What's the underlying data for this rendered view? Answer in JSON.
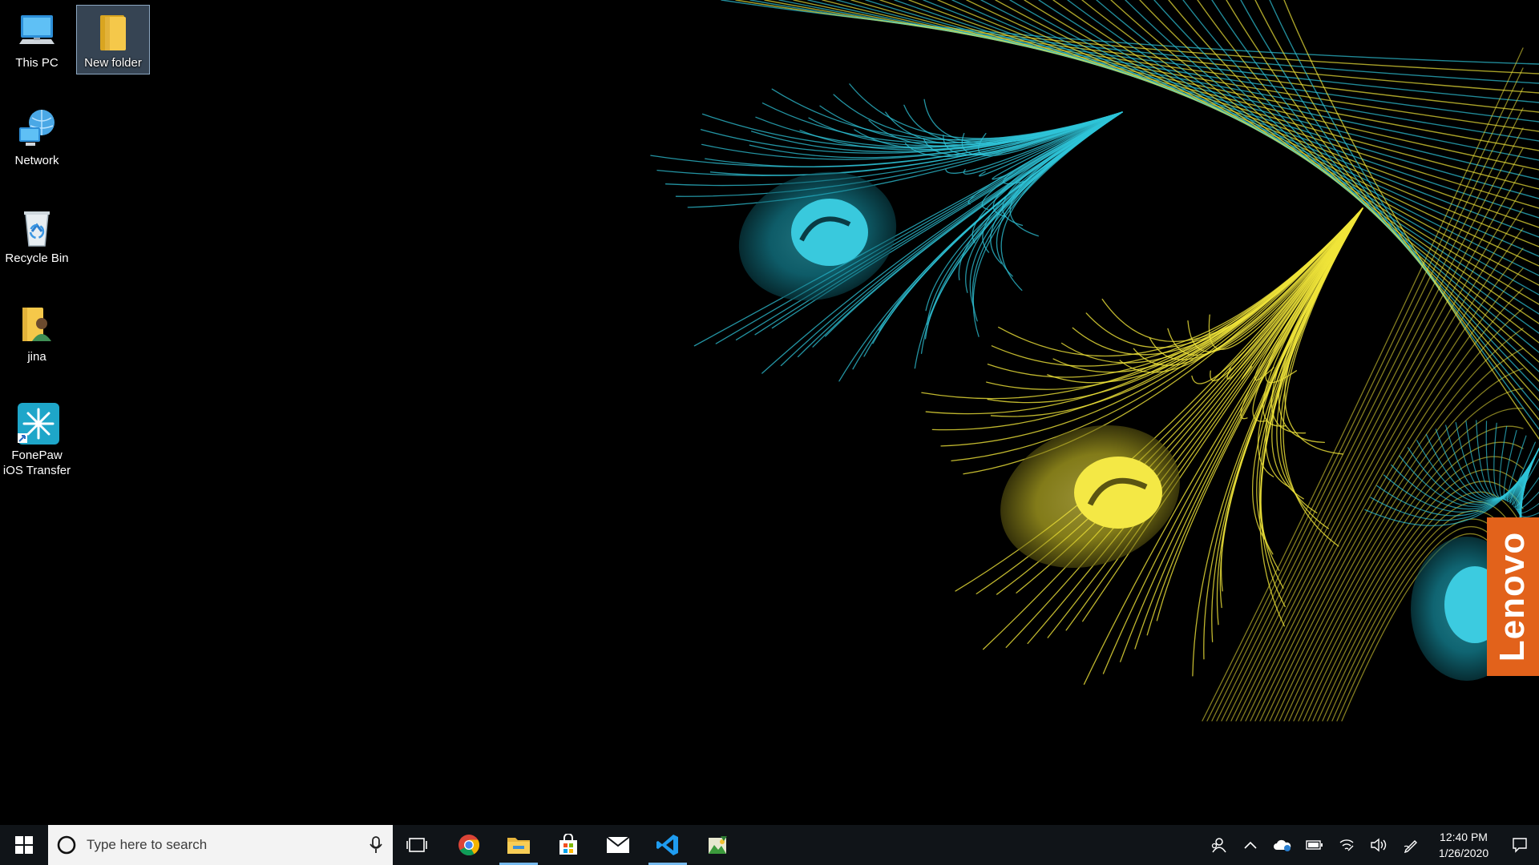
{
  "desktop": {
    "icons": [
      {
        "label": "This PC",
        "icon": "computer-icon"
      },
      {
        "label": "New folder",
        "icon": "folder-icon",
        "selected": true
      },
      {
        "label": "Network",
        "icon": "network-icon"
      },
      {
        "label": "Recycle Bin",
        "icon": "recycle-bin-icon"
      },
      {
        "label": "jina",
        "icon": "user-folder-icon"
      },
      {
        "label": "FonePaw iOS Transfer",
        "icon": "fonepaw-icon"
      }
    ],
    "badge_text": "Lenovo",
    "colors": {
      "badge": "#e2621b",
      "feather_cyan": "#2fc4d8",
      "feather_yellow": "#f0e53a"
    }
  },
  "taskbar": {
    "search_placeholder": "Type here to search",
    "pinned": [
      {
        "name": "chrome-icon",
        "active": false
      },
      {
        "name": "file-explorer-icon",
        "active": true
      },
      {
        "name": "store-icon",
        "active": false
      },
      {
        "name": "mail-icon",
        "active": false
      },
      {
        "name": "vscode-icon",
        "active": true
      },
      {
        "name": "app-icon",
        "active": false
      }
    ],
    "tray": [
      "people-icon",
      "chevron-up-icon",
      "onedrive-icon",
      "battery-icon",
      "wifi-icon",
      "volume-icon",
      "pen-icon"
    ],
    "clock": {
      "time": "12:40 PM",
      "date": "1/26/2020"
    }
  }
}
